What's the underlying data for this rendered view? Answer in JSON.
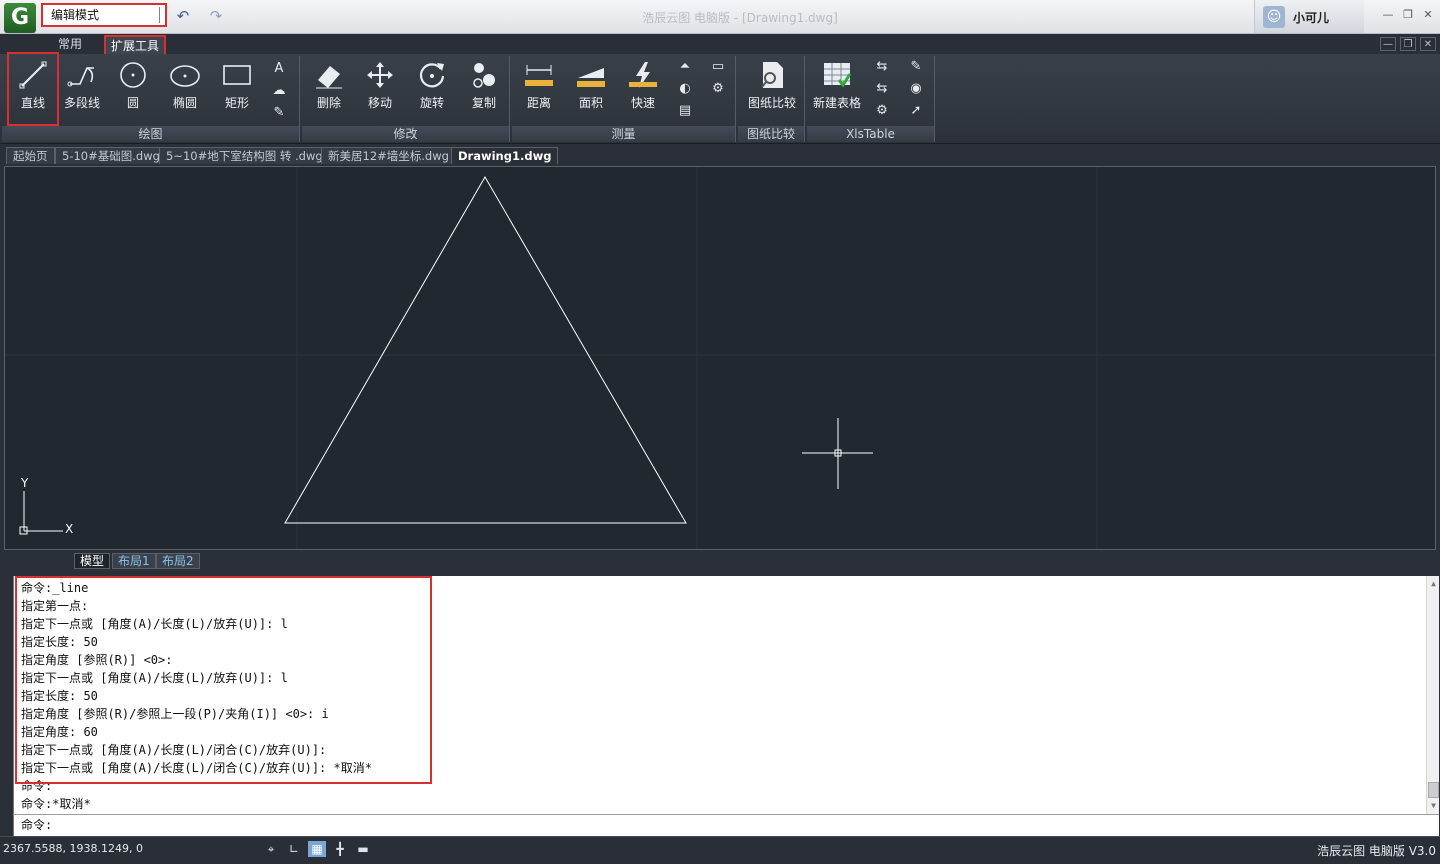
{
  "titlebar": {
    "mode": "编辑模式",
    "title": "浩辰云图 电脑版 - [Drawing1.dwg]",
    "user": "小可儿",
    "logo": "G",
    "icons": [
      "undo-icon",
      "redo-icon",
      "minimize-icon",
      "maximize-icon",
      "close-icon"
    ]
  },
  "ribbon_tabs": [
    "常用",
    "扩展工具"
  ],
  "ribbon": {
    "groups": [
      {
        "title": "绘图",
        "tools": [
          "直线",
          "多段线",
          "圆",
          "椭圆",
          "矩形"
        ]
      },
      {
        "title": "修改",
        "tools": [
          "删除",
          "移动",
          "旋转",
          "复制"
        ]
      },
      {
        "title": "测量",
        "tools": [
          "距离",
          "面积",
          "快速"
        ]
      },
      {
        "title": "图纸比较",
        "tools": [
          "图纸比较"
        ]
      },
      {
        "title": "XlsTable",
        "tools": [
          "新建表格"
        ]
      }
    ],
    "text_tool": "A"
  },
  "doc_tabs": [
    "起始页",
    "5-10#基础图.dwg",
    "5~10#地下室结构图 转 .dwg",
    "新美居12#墙坐标.dwg",
    "Drawing1.dwg"
  ],
  "canvas": {
    "ucs_x": "X",
    "ucs_y": "Y"
  },
  "layout_tabs": [
    "模型",
    "布局1",
    "布局2"
  ],
  "command": {
    "history": [
      "命令:_line",
      "指定第一点:",
      "指定下一点或 [角度(A)/长度(L)/放弃(U)]: l",
      "指定长度: 50",
      "指定角度 [参照(R)] <0>:",
      "指定下一点或 [角度(A)/长度(L)/放弃(U)]: l",
      "指定长度: 50",
      "指定角度 [参照(R)/参照上一段(P)/夹角(I)] <0>: i",
      "指定角度: 60",
      "指定下一点或 [角度(A)/长度(L)/闭合(C)/放弃(U)]:",
      "指定下一点或 [角度(A)/长度(L)/闭合(C)/放弃(U)]: *取消*",
      "命令:",
      "命令:*取消*"
    ],
    "prompt": "命令:"
  },
  "status": {
    "coords": "2367.5588, 1938.1249, 0",
    "version": "浩辰云图 电脑版 V3.0"
  }
}
